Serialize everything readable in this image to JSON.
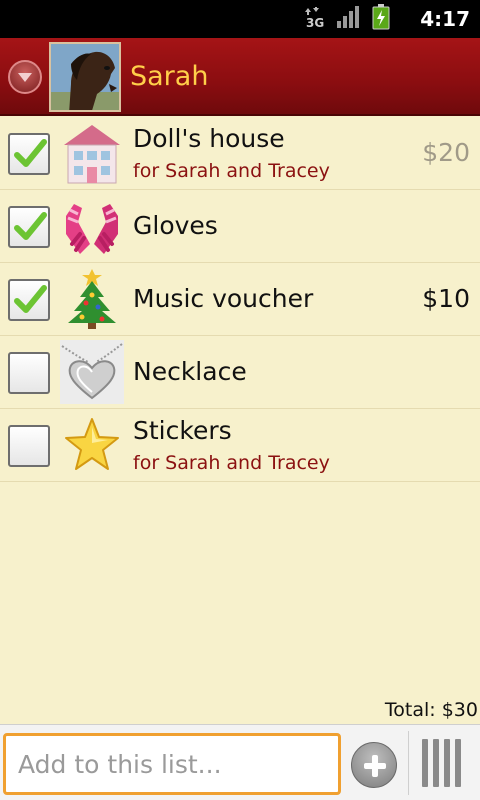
{
  "status_bar": {
    "network_label": "3G",
    "time": "4:17"
  },
  "header": {
    "list_owner": "Sarah",
    "avatar_icon": "horse-avatar"
  },
  "items": [
    {
      "name": "Doll's house",
      "subtitle": "for Sarah and Tracey",
      "price": "$20",
      "checked": true,
      "thumbnail_icon": "dollhouse-icon"
    },
    {
      "name": "Gloves",
      "subtitle": "",
      "price": "",
      "checked": true,
      "thumbnail_icon": "gloves-icon"
    },
    {
      "name": "Music voucher",
      "subtitle": "",
      "price": "$10",
      "checked": true,
      "thumbnail_icon": "christmas-tree-icon"
    },
    {
      "name": "Necklace",
      "subtitle": "",
      "price": "",
      "checked": false,
      "thumbnail_icon": "heart-locket-icon"
    },
    {
      "name": "Stickers",
      "subtitle": "for Sarah and Tracey",
      "price": "",
      "checked": false,
      "thumbnail_icon": "star-icon"
    }
  ],
  "total": "Total: $30",
  "add_bar": {
    "placeholder": "Add to this list...",
    "value": ""
  },
  "colors": {
    "header_red": "#8a0d10",
    "owner_name": "#ffcf4a",
    "subtitle": "#8b1111",
    "list_bg": "#f7f1cc",
    "input_focus": "#f0a030",
    "check_green": "#6cc433"
  }
}
